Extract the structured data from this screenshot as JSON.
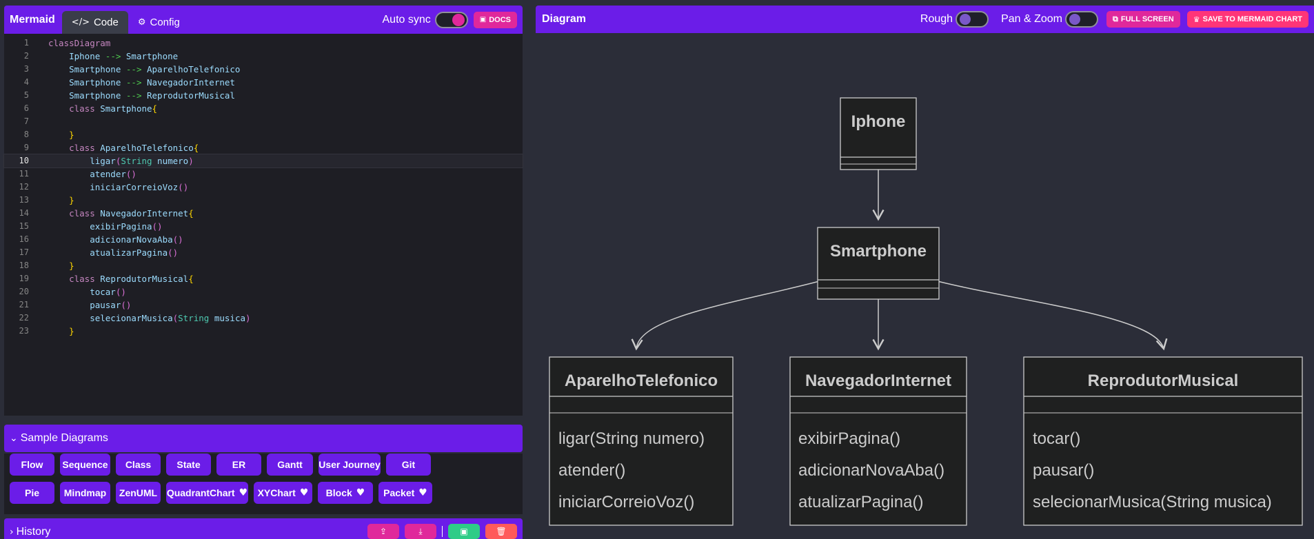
{
  "editor_panel": {
    "brand": "Mermaid",
    "tabs": [
      {
        "label": "Code",
        "icon": "code-icon"
      },
      {
        "label": "Config",
        "icon": "gears-icon"
      }
    ],
    "auto_sync_label": "Auto sync",
    "auto_sync_on": true,
    "docs_label": "DOCS"
  },
  "code_lines": [
    "classDiagram",
    "    Iphone --> Smartphone",
    "    Smartphone --> AparelhoTelefonico",
    "    Smartphone --> NavegadorInternet",
    "    Smartphone --> ReprodutorMusical",
    "    class Smartphone{",
    "",
    "    }",
    "    class AparelhoTelefonico{",
    "        ligar(String numero)",
    "        atender()",
    "        iniciarCorreioVoz()",
    "    }",
    "    class NavegadorInternet{",
    "        exibirPagina()",
    "        adicionarNovaAba()",
    "        atualizarPagina()",
    "    }",
    "    class ReprodutorMusical{",
    "        tocar()",
    "        pausar()",
    "        selecionarMusica(String musica)",
    "    }"
  ],
  "current_line": 10,
  "samples": {
    "title": "Sample Diagrams",
    "row1": [
      "Flow",
      "Sequence",
      "Class",
      "State",
      "ER",
      "Gantt",
      "User Journey",
      "Git"
    ],
    "row2": [
      "Pie",
      "Mindmap",
      "ZenUML",
      "QuadrantChart",
      "XYChart",
      "Block",
      "Packet"
    ],
    "row2_hearts": [
      false,
      false,
      false,
      true,
      true,
      true,
      true
    ]
  },
  "history": {
    "title": "History",
    "actions": [
      {
        "icon": "upload-icon",
        "color": "#e0289b"
      },
      {
        "icon": "download-icon",
        "color": "#e0289b"
      },
      {
        "icon": "save-icon",
        "color": "#2ecc87"
      },
      {
        "icon": "trash-icon",
        "color": "#ff5a5a"
      }
    ]
  },
  "diagram_panel": {
    "title": "Diagram",
    "rough_label": "Rough",
    "rough_on": false,
    "pan_zoom_label": "Pan & Zoom",
    "pan_zoom_on": false,
    "fullscreen_label": "FULL SCREEN",
    "save_label": "SAVE TO MERMAID CHART"
  },
  "classes": {
    "iphone": {
      "name": "Iphone",
      "methods": []
    },
    "smartphone": {
      "name": "Smartphone",
      "methods": []
    },
    "aparelho": {
      "name": "AparelhoTelefonico",
      "methods": [
        "ligar(String numero)",
        "atender()",
        "iniciarCorreioVoz()"
      ]
    },
    "navegador": {
      "name": "NavegadorInternet",
      "methods": [
        "exibirPagina()",
        "adicionarNovaAba()",
        "atualizarPagina()"
      ]
    },
    "reprodutor": {
      "name": "ReprodutorMusical",
      "methods": [
        "tocar()",
        "pausar()",
        "selecionarMusica(String musica)"
      ]
    }
  },
  "colors": {
    "accent": "#6b1de8",
    "pink": "#e0289b",
    "save_pink": "#ff3578",
    "canvas": "#2b2d38",
    "node_fill": "#1f2020",
    "node_stroke": "#cccccc"
  }
}
